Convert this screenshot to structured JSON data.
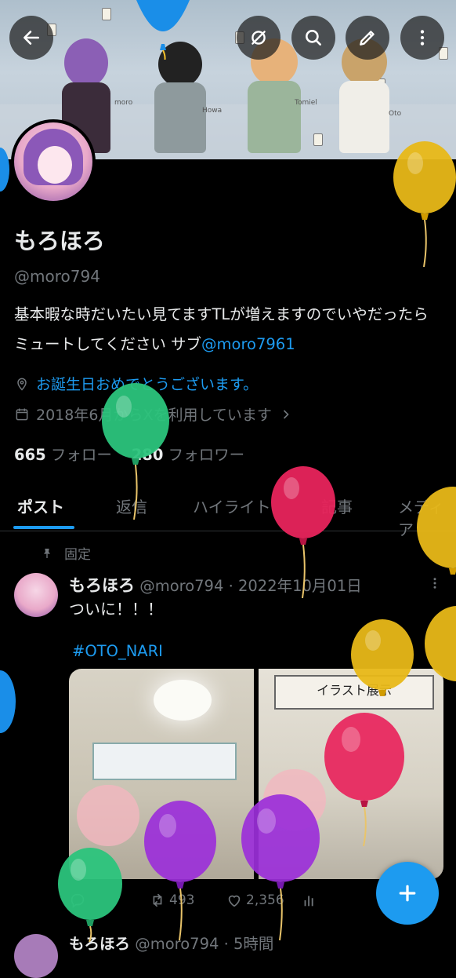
{
  "header": {
    "banner_labels": [
      "moro",
      "Howa",
      "Tomiel",
      "Oto"
    ],
    "buttons": {
      "back": "back-arrow-icon",
      "grok": "grok-icon",
      "search": "search-icon",
      "edit": "edit-icon",
      "more": "more-vertical-icon"
    }
  },
  "profile": {
    "name": "もろほろ",
    "handle": "@moro794",
    "bio_text": "基本暇な時だいたい見てますTLが増えますのでいやだったらミュートしてください サブ",
    "bio_link": "@moro7961",
    "birthday_text": "お誕生日おめでとうございます。",
    "joined_text": "2018年6月からXを利用しています",
    "following_count": "665",
    "following_label": "フォロー",
    "followers_count": "280",
    "followers_label": "フォロワー"
  },
  "tabs": [
    {
      "label": "ポスト",
      "active": true
    },
    {
      "label": "返信",
      "active": false
    },
    {
      "label": "ハイライト",
      "active": false
    },
    {
      "label": "記事",
      "active": false
    },
    {
      "label": "メディア",
      "active": false
    }
  ],
  "pinned_post": {
    "pinned_label": "固定",
    "author_name": "もろほろ",
    "author_handle": "@moro794",
    "date": "2022年10月01日",
    "text": "ついに！！！",
    "hashtag": "#OTO_NARI",
    "photo2_sign": "イラスト展示",
    "retweets": "493",
    "likes": "2,356"
  },
  "next_post": {
    "author_name": "もろほろ",
    "author_handle": "@moro794",
    "time": "5時間"
  },
  "colors": {
    "accent": "#1d9bf0",
    "background": "#000000",
    "text": "#e7e9ea",
    "muted": "#71767b",
    "balloon_yellow": "#e8b818",
    "balloon_green": "#2bc47c",
    "balloon_pink": "#e8245c",
    "balloon_purple": "#9b2fd9",
    "balloon_blue": "#1a8ee8"
  }
}
